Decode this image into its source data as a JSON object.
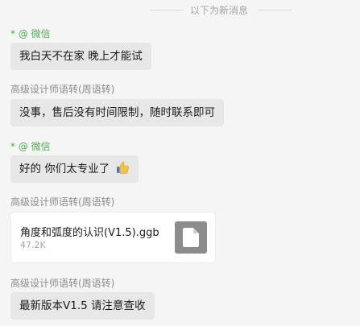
{
  "divider_text": "以下为新消息",
  "messages": [
    {
      "sender": "* @ 微信",
      "text": "我白天不在家 晚上才能试"
    },
    {
      "sender": "高级设计师语转(周语转)",
      "text": "没事，售后没有时间限制，随时联系即可"
    },
    {
      "sender": "* @ 微信",
      "text": "好的 你们太专业了",
      "emoji": "thumbs-up-icon"
    },
    {
      "sender": "高级设计师语转(周语转)",
      "file": {
        "name": "角度和弧度的认识(V1.5).ggb",
        "size": "47.2K",
        "icon": "document-icon"
      }
    },
    {
      "sender": "高级设计师语转(周语转)",
      "text": "最新版本V1.5  请注意查收"
    }
  ]
}
